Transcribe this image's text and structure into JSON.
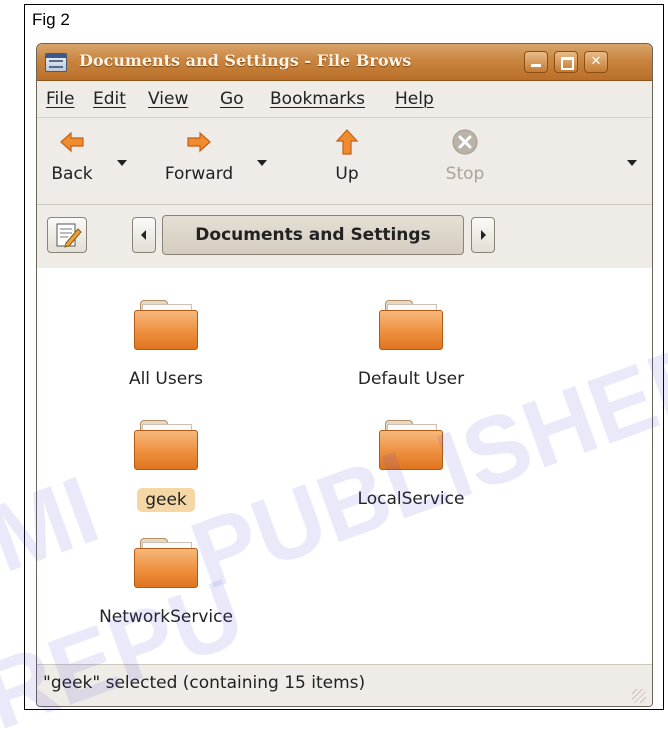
{
  "figure": {
    "label": "Fig 2"
  },
  "window": {
    "title": "Documents and Settings - File Brows"
  },
  "menu": {
    "items": [
      "File",
      "Edit",
      "View",
      "Go",
      "Bookmarks",
      "Help"
    ]
  },
  "toolbar": {
    "back_label": "Back",
    "forward_label": "Forward",
    "up_label": "Up",
    "stop_label": "Stop"
  },
  "location": {
    "current": "Documents and Settings"
  },
  "files": {
    "items": [
      {
        "name": "All Users",
        "selected": false
      },
      {
        "name": "Default User",
        "selected": false
      },
      {
        "name": "geek",
        "selected": true
      },
      {
        "name": "LocalService",
        "selected": false
      },
      {
        "name": "NetworkService",
        "selected": false
      }
    ]
  },
  "status": {
    "text": "\"geek\" selected (containing 15 items)"
  },
  "watermark": {
    "line1": "PUBLISHED",
    "line2": "MI",
    "line3": "REPU"
  },
  "colors": {
    "titlebar": "#c9853f",
    "folder": "#ef9343",
    "selection": "#f5d7a6",
    "back_forward_arrow": "#f08b2e",
    "stop_icon": "#a9a39a"
  }
}
